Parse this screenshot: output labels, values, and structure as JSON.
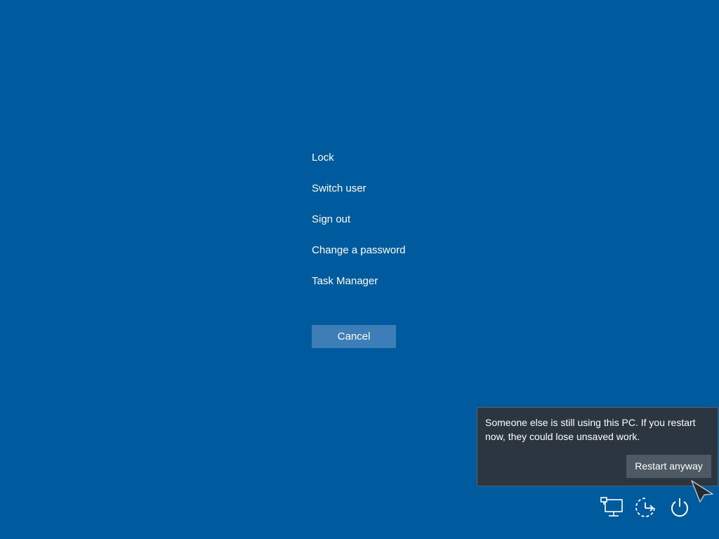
{
  "menu": {
    "items": [
      {
        "label": "Lock"
      },
      {
        "label": "Switch user"
      },
      {
        "label": "Sign out"
      },
      {
        "label": "Change a password"
      },
      {
        "label": "Task Manager"
      }
    ],
    "cancel_label": "Cancel"
  },
  "flyout": {
    "message": "Someone else is still using this PC. If you restart now, they could lose unsaved work.",
    "restart_label": "Restart anyway"
  },
  "tray": {
    "icons": [
      "network-icon",
      "ease-of-access-icon",
      "power-icon"
    ]
  },
  "colors": {
    "background": "#005a9e",
    "cancel_button": "#3d7db8",
    "flyout_background": "#2b3640",
    "flyout_button": "#4e5963"
  }
}
